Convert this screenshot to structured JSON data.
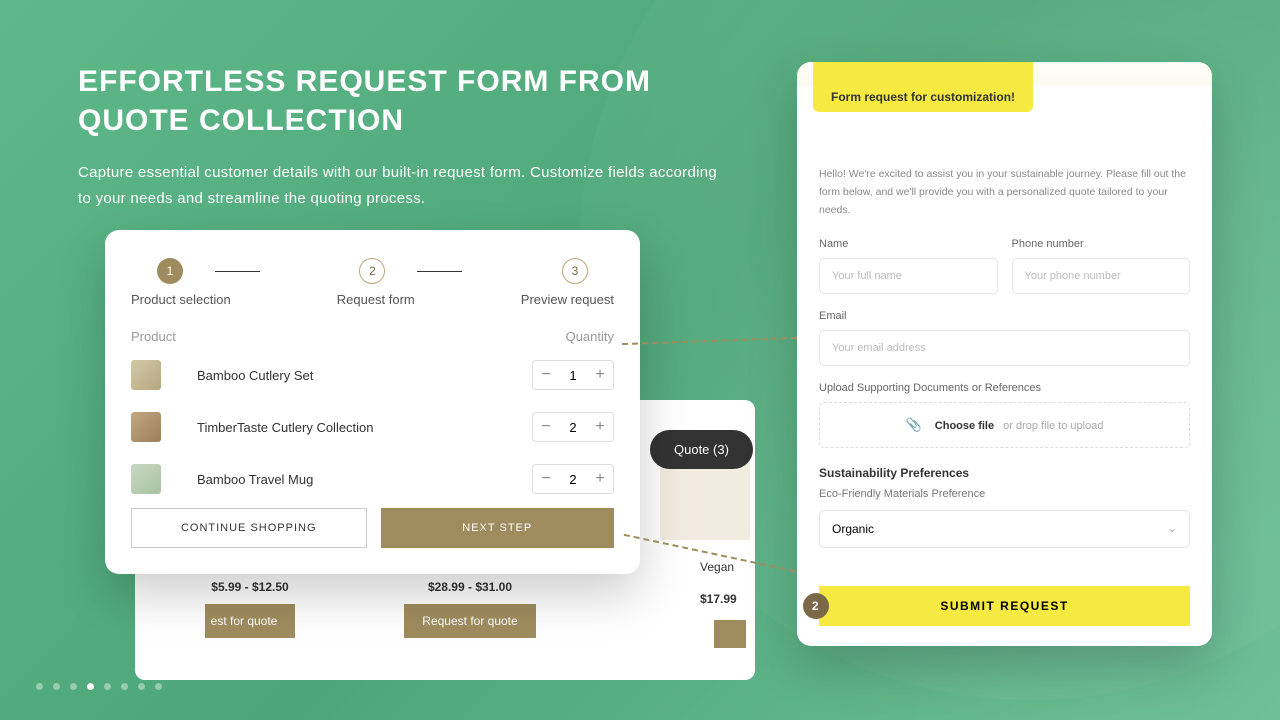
{
  "hero": {
    "title": "EFFORTLESS REQUEST FORM FROM QUOTE COLLECTION",
    "subtitle": "Capture essential customer details with our built-in request form. Customize fields according to your needs and streamline the quoting process."
  },
  "wizard": {
    "steps": [
      "1",
      "2",
      "3"
    ],
    "labels": {
      "s1": "Product selection",
      "s2": "Request form",
      "s3": "Preview request"
    },
    "headers": {
      "product": "Product",
      "quantity": "Quantity"
    },
    "products": [
      {
        "name": "Bamboo Cutlery Set",
        "qty": "1"
      },
      {
        "name": "TimberTaste Cutlery Collection",
        "qty": "2"
      },
      {
        "name": "Bamboo Travel Mug",
        "qty": "2"
      }
    ],
    "actions": {
      "continue": "CONTINUE SHOPPING",
      "next": "NEXT STEP"
    }
  },
  "bg": {
    "price1": "$5.99 - $12.50",
    "price2": "$28.99 - $31.00",
    "price3": "$17.99",
    "req": "Request for quote",
    "req_short": "est for quote",
    "vegan": "Vegan",
    "quote_pill": "Quote (3)"
  },
  "form": {
    "badge": "Form request for customization!",
    "intro": "Hello! We're excited to assist you in your sustainable journey. Please fill out the form below, and we'll provide you with a personalized quote tailored to your needs.",
    "name_label": "Name",
    "name_ph": "Your full name",
    "phone_label": "Phone number",
    "phone_ph": "Your phone number",
    "email_label": "Email",
    "email_ph": "Your email address",
    "upload_label": "Upload Supporting Documents or References",
    "choose": "Choose file",
    "or_drop": "or drop file to upload",
    "pref_head": "Sustainability Preferences",
    "pref_sub": "Eco-Friendly Materials Preference",
    "select_val": "Organic",
    "submit": "SUBMIT REQUEST",
    "submit_badge": "2"
  }
}
